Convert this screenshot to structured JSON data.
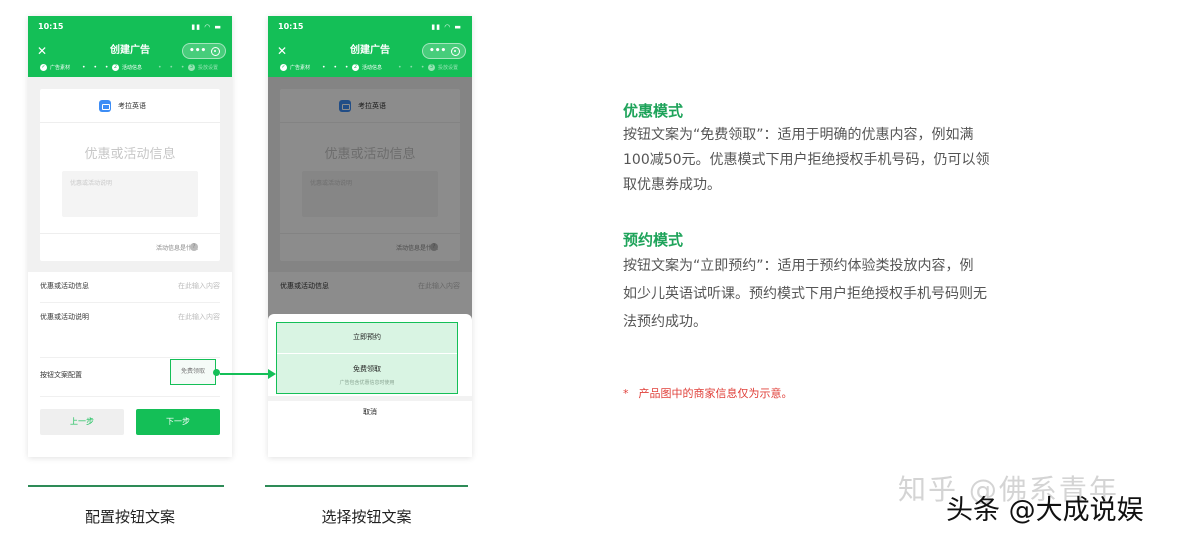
{
  "phones": {
    "status_time": "10:15",
    "nav_title": "创建广告",
    "capsule_dots": "•••",
    "steps": [
      "广告素材",
      "活动信息",
      "投放设置"
    ],
    "step_nums": [
      "✓",
      "2",
      "3"
    ],
    "brand_name": "考拉英语",
    "promo_title": "优惠或活动信息",
    "promo_desc_placeholder": "优惠或活动说明",
    "help_text": "活动信息是什么",
    "form": {
      "row1_label": "优惠或活动信息",
      "row1_placeholder": "在此输入内容",
      "row2_label": "优惠或活动说明",
      "row2_placeholder": "在此输入内容",
      "row3_label": "按钮文案配置",
      "button_value": "免费领取"
    },
    "prev_label": "上一步",
    "next_label": "下一步",
    "sheet": {
      "option1": "立即预约",
      "option2": "免费领取",
      "option2_sub": "广告包含优惠信息时使用",
      "cancel": "取消"
    }
  },
  "captions": [
    "配置按钮文案",
    "选择按钮文案"
  ],
  "sections": [
    {
      "title": "优惠模式",
      "lines": [
        "按钮文案为“免费领取”：适用于明确的优惠内容，例如满",
        "100减50元。优惠模式下用户拒绝授权手机号码，仍可以领",
        "取优惠券成功。"
      ]
    },
    {
      "title": "预约模式",
      "lines": [
        "按钮文案为“立即预约”：适用于预约体验类投放内容，例",
        "如少儿英语试听课。预约模式下用户拒绝授权手机号码则无",
        "法预约成功。"
      ]
    }
  ],
  "note": {
    "star": "*",
    "text": "产品图中的商家信息仅为示意。"
  },
  "watermarks": {
    "zhihu": "知乎 @佛系青年",
    "toutiao": "头条 @大成说娱"
  },
  "colors": {
    "brand_green": "#14bf57",
    "title_green": "#1ea35a",
    "note_red": "#e0403a"
  }
}
